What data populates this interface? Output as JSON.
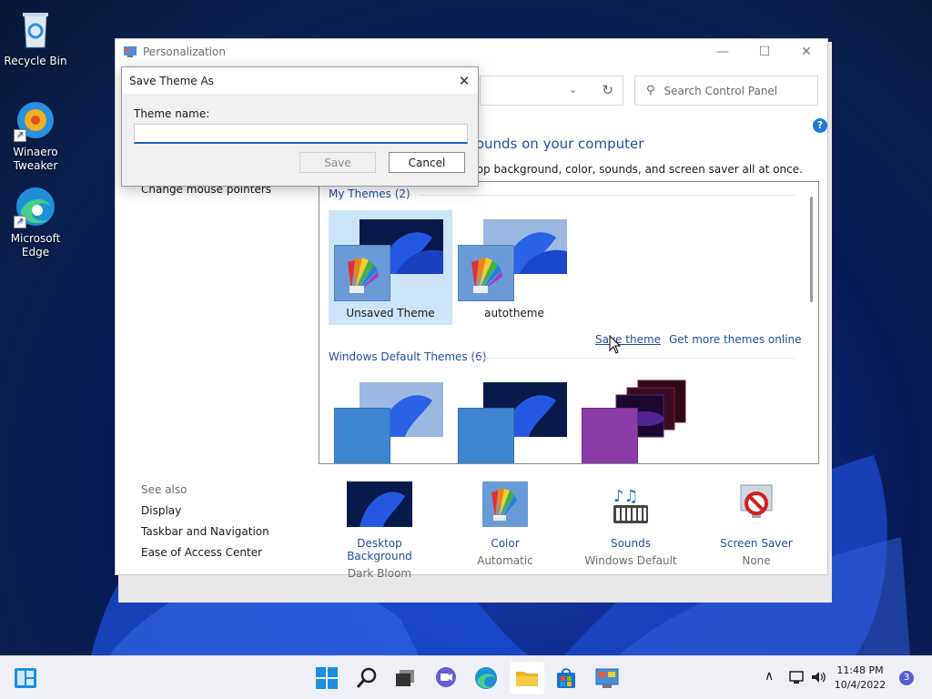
{
  "desktop": {
    "icons": [
      {
        "label": "Recycle Bin"
      },
      {
        "label": "Winaero Tweaker"
      },
      {
        "label": "Microsoft Edge"
      }
    ]
  },
  "window": {
    "title": "Personalization",
    "search_placeholder": "Search Control Panel",
    "heading": "sounds on your computer",
    "subtext": "top background, color, sounds, and screen saver all at once.",
    "left_link": "Change mouse pointers",
    "my_themes": {
      "title": "My Themes (2)",
      "items": [
        {
          "label": "Unsaved Theme",
          "selected": true
        },
        {
          "label": "autotheme",
          "selected": false
        }
      ]
    },
    "save_theme_link": "Save theme",
    "more_themes_link": "Get more themes online",
    "default_themes": {
      "title": "Windows Default Themes (6)"
    },
    "see_also": {
      "title": "See also",
      "links": [
        "Display",
        "Taskbar and Navigation",
        "Ease of Access Center"
      ]
    },
    "bottom_items": [
      {
        "title": "Desktop Background",
        "value": "Dark Bloom"
      },
      {
        "title": "Color",
        "value": "Automatic"
      },
      {
        "title": "Sounds",
        "value": "Windows Default"
      },
      {
        "title": "Screen Saver",
        "value": "None"
      }
    ]
  },
  "dialog": {
    "title": "Save Theme As",
    "field_label": "Theme name:",
    "field_value": "",
    "save_label": "Save",
    "cancel_label": "Cancel"
  },
  "taskbar": {
    "time": "11:48 PM",
    "date": "10/4/2022",
    "notification_count": "3"
  },
  "colors": {
    "accent": "#1a62c6",
    "link": "#1f4fa0",
    "selection": "#cce4f7"
  }
}
